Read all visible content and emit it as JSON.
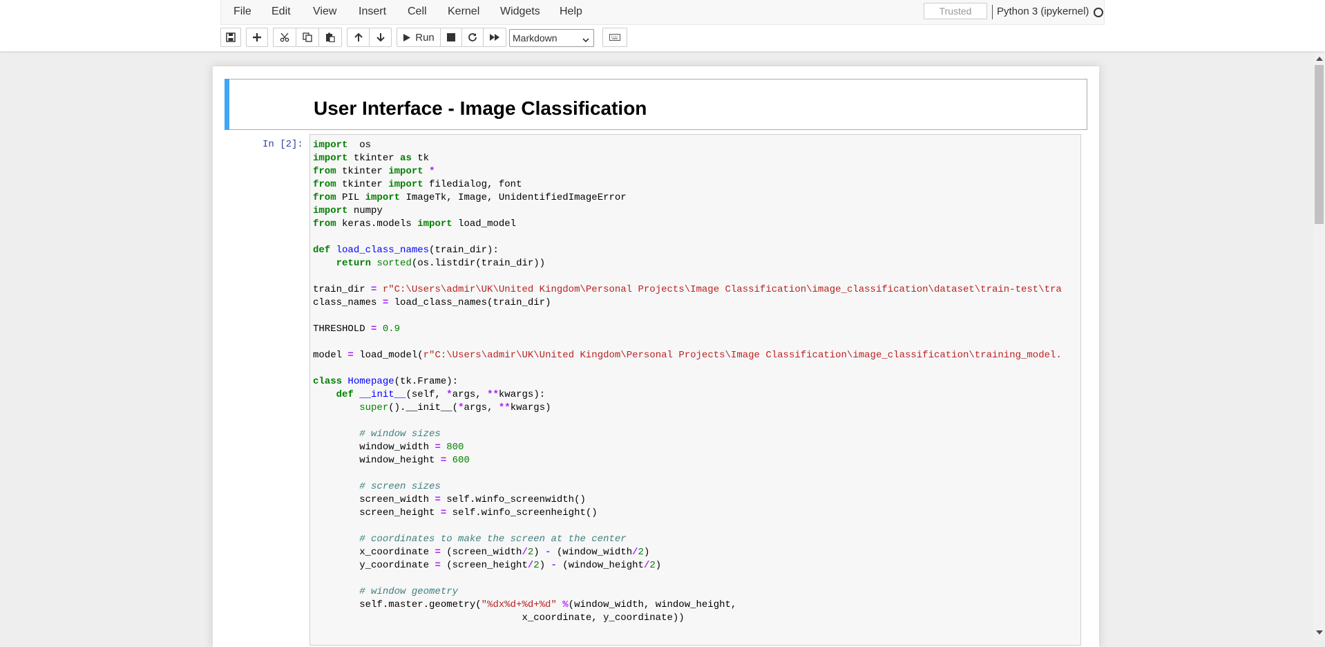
{
  "menu": {
    "file": "File",
    "edit": "Edit",
    "view": "View",
    "insert": "Insert",
    "cell": "Cell",
    "kernel": "Kernel",
    "widgets": "Widgets",
    "help": "Help"
  },
  "status": {
    "trusted": "Trusted",
    "kernel_name": "Python 3 (ipykernel)"
  },
  "toolbar": {
    "run_label": "Run",
    "cell_type": "Markdown",
    "icons": [
      "save-icon",
      "plus-icon",
      "cut-icon",
      "copy-icon",
      "paste-icon",
      "arrow-up-icon",
      "arrow-down-icon",
      "play-icon",
      "stop-icon",
      "restart-icon",
      "fast-forward-icon",
      "keyboard-icon"
    ]
  },
  "notebook": {
    "markdown_heading": "User Interface - Image Classification",
    "prompt": "In [2]:",
    "code_lines": [
      [
        [
          "kw",
          "import"
        ],
        [
          "",
          "  os"
        ]
      ],
      [
        [
          "kw",
          "import"
        ],
        [
          "",
          " tkinter "
        ],
        [
          "kw",
          "as"
        ],
        [
          "",
          " tk"
        ]
      ],
      [
        [
          "kw",
          "from"
        ],
        [
          "",
          " tkinter "
        ],
        [
          "kw",
          "import"
        ],
        [
          "",
          " "
        ],
        [
          "op",
          "*"
        ]
      ],
      [
        [
          "kw",
          "from"
        ],
        [
          "",
          " tkinter "
        ],
        [
          "kw",
          "import"
        ],
        [
          "",
          " filedialog, font"
        ]
      ],
      [
        [
          "kw",
          "from"
        ],
        [
          "",
          " PIL "
        ],
        [
          "kw",
          "import"
        ],
        [
          "",
          " ImageTk, Image, UnidentifiedImageError"
        ]
      ],
      [
        [
          "kw",
          "import"
        ],
        [
          "",
          " numpy"
        ]
      ],
      [
        [
          "kw",
          "from"
        ],
        [
          "",
          " keras.models "
        ],
        [
          "kw",
          "import"
        ],
        [
          "",
          " load_model"
        ]
      ],
      [],
      [
        [
          "kw",
          "def"
        ],
        [
          "",
          " "
        ],
        [
          "fn",
          "load_class_names"
        ],
        [
          "",
          "(train_dir):"
        ]
      ],
      [
        [
          "",
          "    "
        ],
        [
          "kw",
          "return"
        ],
        [
          "",
          " "
        ],
        [
          "bi",
          "sorted"
        ],
        [
          "",
          "(os.listdir(train_dir))"
        ]
      ],
      [],
      [
        [
          "",
          "train_dir "
        ],
        [
          "op",
          "="
        ],
        [
          "",
          " "
        ],
        [
          "st",
          "r\"C:\\Users\\admir\\UK\\United Kingdom\\Personal Projects\\Image Classification\\image_classification\\dataset\\train-test\\tra"
        ]
      ],
      [
        [
          "",
          "class_names "
        ],
        [
          "op",
          "="
        ],
        [
          "",
          " load_class_names(train_dir)"
        ]
      ],
      [],
      [
        [
          "",
          "THRESHOLD "
        ],
        [
          "op",
          "="
        ],
        [
          "",
          " "
        ],
        [
          "nm",
          "0.9"
        ]
      ],
      [],
      [
        [
          "",
          "model "
        ],
        [
          "op",
          "="
        ],
        [
          "",
          " load_model("
        ],
        [
          "st",
          "r\"C:\\Users\\admir\\UK\\United Kingdom\\Personal Projects\\Image Classification\\image_classification\\training_model."
        ]
      ],
      [],
      [
        [
          "kw",
          "class"
        ],
        [
          "",
          " "
        ],
        [
          "fn",
          "Homepage"
        ],
        [
          "",
          "(tk.Frame):"
        ]
      ],
      [
        [
          "",
          "    "
        ],
        [
          "kw",
          "def"
        ],
        [
          "",
          " "
        ],
        [
          "fn",
          "__init__"
        ],
        [
          "",
          "(self, "
        ],
        [
          "op",
          "*"
        ],
        [
          "",
          "args, "
        ],
        [
          "op",
          "**"
        ],
        [
          "",
          "kwargs):"
        ]
      ],
      [
        [
          "",
          "        "
        ],
        [
          "bi",
          "super"
        ],
        [
          "",
          "().__init__("
        ],
        [
          "op",
          "*"
        ],
        [
          "",
          "args, "
        ],
        [
          "op",
          "**"
        ],
        [
          "",
          "kwargs)"
        ]
      ],
      [],
      [
        [
          "",
          "        "
        ],
        [
          "cm",
          "# window sizes"
        ]
      ],
      [
        [
          "",
          "        window_width "
        ],
        [
          "op",
          "="
        ],
        [
          "",
          " "
        ],
        [
          "nm",
          "800"
        ]
      ],
      [
        [
          "",
          "        window_height "
        ],
        [
          "op",
          "="
        ],
        [
          "",
          " "
        ],
        [
          "nm",
          "600"
        ]
      ],
      [],
      [
        [
          "",
          "        "
        ],
        [
          "cm",
          "# screen sizes"
        ]
      ],
      [
        [
          "",
          "        screen_width "
        ],
        [
          "op",
          "="
        ],
        [
          "",
          " self.winfo_screenwidth()"
        ]
      ],
      [
        [
          "",
          "        screen_height "
        ],
        [
          "op",
          "="
        ],
        [
          "",
          " self.winfo_screenheight()"
        ]
      ],
      [],
      [
        [
          "",
          "        "
        ],
        [
          "cm",
          "# coordinates to make the screen at the center"
        ]
      ],
      [
        [
          "",
          "        x_coordinate "
        ],
        [
          "op",
          "="
        ],
        [
          "",
          " (screen_width"
        ],
        [
          "op",
          "/"
        ],
        [
          "nm",
          "2"
        ],
        [
          "",
          ") "
        ],
        [
          "op",
          "-"
        ],
        [
          "",
          " (window_width"
        ],
        [
          "op",
          "/"
        ],
        [
          "nm",
          "2"
        ],
        [
          "",
          ")"
        ]
      ],
      [
        [
          "",
          "        y_coordinate "
        ],
        [
          "op",
          "="
        ],
        [
          "",
          " (screen_height"
        ],
        [
          "op",
          "/"
        ],
        [
          "nm",
          "2"
        ],
        [
          "",
          ") "
        ],
        [
          "op",
          "-"
        ],
        [
          "",
          " (window_height"
        ],
        [
          "op",
          "/"
        ],
        [
          "nm",
          "2"
        ],
        [
          "",
          ")"
        ]
      ],
      [],
      [
        [
          "",
          "        "
        ],
        [
          "cm",
          "# window geometry"
        ]
      ],
      [
        [
          "",
          "        self.master.geometry("
        ],
        [
          "st",
          "\"%dx%d+%d+%d\""
        ],
        [
          "",
          " "
        ],
        [
          "op",
          "%"
        ],
        [
          "",
          "(window_width, window_height,"
        ]
      ],
      [
        [
          "",
          "                                    x_coordinate, y_coordinate))"
        ]
      ]
    ]
  }
}
